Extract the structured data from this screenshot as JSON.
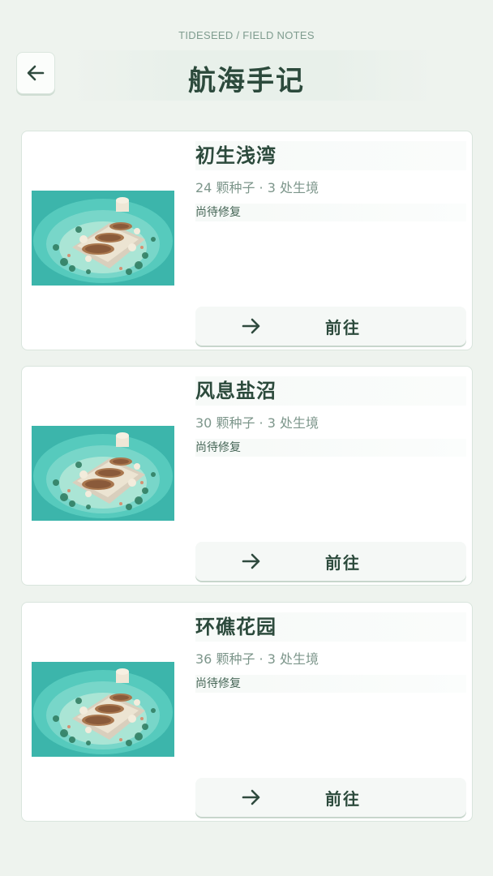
{
  "header": {
    "subtitle": "TIDESEED / FIELD NOTES",
    "title": "航海手记",
    "back_icon": "arrow-left-icon"
  },
  "cards": [
    {
      "title": "初生浅湾",
      "meta": "24 颗种子 · 3 处生境",
      "status": "尚待修复",
      "button_label": "前往",
      "button_icon": "arrow-right-icon",
      "image": "island-thumbnail"
    },
    {
      "title": "风息盐沼",
      "meta": "30 颗种子 · 3 处生境",
      "status": "尚待修复",
      "button_label": "前往",
      "button_icon": "arrow-right-icon",
      "image": "island-thumbnail"
    },
    {
      "title": "环礁花园",
      "meta": "36 颗种子 · 3 处生境",
      "status": "尚待修复",
      "button_label": "前往",
      "button_icon": "arrow-right-icon",
      "image": "island-thumbnail"
    }
  ],
  "colors": {
    "background": "#eef3ee",
    "text_primary": "#2c4a3c",
    "text_muted": "#7d968b",
    "water": "#3fbcb2"
  }
}
